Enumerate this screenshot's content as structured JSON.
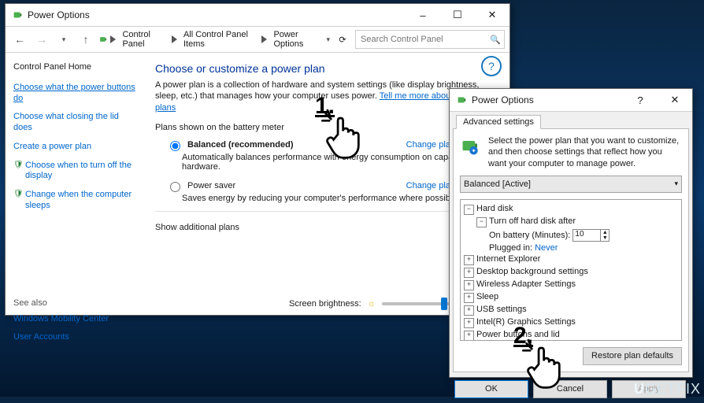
{
  "win1": {
    "title": "Power Options",
    "breadcrumb": [
      "Control Panel",
      "All Control Panel Items",
      "Power Options"
    ],
    "search_placeholder": "Search Control Panel",
    "sidebar": {
      "home": "Control Panel Home",
      "links": [
        "Choose what the power buttons do",
        "Choose what closing the lid does",
        "Create a power plan",
        "Choose when to turn off the display",
        "Change when the computer sleeps"
      ],
      "see_also_label": "See also",
      "see_also": [
        "Windows Mobility Center",
        "User Accounts"
      ]
    },
    "main": {
      "heading": "Choose or customize a power plan",
      "desc": "A power plan is a collection of hardware and system settings (like display brightness, sleep, etc.) that manages how your computer uses power. ",
      "tell_me_more": "Tell me more about power plans",
      "group_label": "Plans shown on the battery meter",
      "plans": [
        {
          "label": "Balanced (recommended)",
          "checked": true,
          "sub": "Automatically balances performance with energy consumption on capable hardware.",
          "change": "Change plan settings"
        },
        {
          "label": "Power saver",
          "checked": false,
          "sub": "Saves energy by reducing your computer's performance where possible.",
          "change": "Change plan settings"
        }
      ],
      "show_additional": "Show additional plans",
      "brightness_label": "Screen brightness:"
    }
  },
  "dlg": {
    "title": "Power Options",
    "tab": "Advanced settings",
    "desc": "Select the power plan that you want to customize, and then choose settings that reflect how you want your computer to manage power.",
    "combo": "Balanced [Active]",
    "tree": [
      {
        "lvl": 1,
        "exp": "-",
        "text": "Hard disk"
      },
      {
        "lvl": 2,
        "exp": "-",
        "text": "Turn off hard disk after"
      },
      {
        "lvl": 3,
        "exp": "",
        "text": "On battery (Minutes):",
        "input": "10"
      },
      {
        "lvl": 3,
        "exp": "",
        "text": "Plugged in:",
        "link": "Never"
      },
      {
        "lvl": 1,
        "exp": "+",
        "text": "Internet Explorer"
      },
      {
        "lvl": 1,
        "exp": "+",
        "text": "Desktop background settings"
      },
      {
        "lvl": 1,
        "exp": "+",
        "text": "Wireless Adapter Settings"
      },
      {
        "lvl": 1,
        "exp": "+",
        "text": "Sleep"
      },
      {
        "lvl": 1,
        "exp": "+",
        "text": "USB settings"
      },
      {
        "lvl": 1,
        "exp": "+",
        "text": "Intel(R) Graphics Settings"
      },
      {
        "lvl": 1,
        "exp": "+",
        "text": "Power buttons and lid"
      }
    ],
    "restore": "Restore plan defaults",
    "ok": "OK",
    "cancel": "Cancel",
    "apply": "Apply"
  },
  "annot": {
    "one": "1.",
    "two": "2."
  },
  "watermark": {
    "a": "U",
    "b": "GETFIX"
  }
}
